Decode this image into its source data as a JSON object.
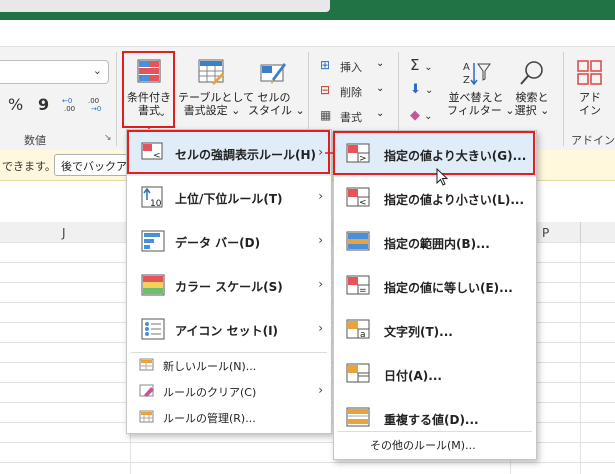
{
  "ribbon": {
    "number_group_label": "数値",
    "percent_symbol": "%",
    "comma_symbol": "9",
    "cond_format_label1": "条件付き",
    "cond_format_label2": "書式",
    "table_format_label1": "テーブルとして",
    "table_format_label2": "書式設定",
    "cell_style_label1": "セルの",
    "cell_style_label2": "スタイル",
    "insert_label": "挿入",
    "delete_label": "削除",
    "format_label": "書式",
    "sort_filter_label1": "並べ替えと",
    "sort_filter_label2": "フィルター",
    "find_select_label1": "検索と",
    "find_select_label2": "選択",
    "addin_label1": "アド",
    "addin_label2": "イン",
    "addin_group_label": "アドイン"
  },
  "infobar": {
    "message": "できます。",
    "button_label": "後でバックアップ"
  },
  "grid": {
    "col_j": "J",
    "col_p": "P"
  },
  "menu_main": {
    "items": [
      {
        "label": "セルの強調表示ルール(H)",
        "icon": "highlight-rules-icon"
      },
      {
        "label": "上位/下位ルール(T)",
        "icon": "top-bottom-icon"
      },
      {
        "label": "データ バー(D)",
        "icon": "data-bar-icon"
      },
      {
        "label": "カラー スケール(S)",
        "icon": "color-scale-icon"
      },
      {
        "label": "アイコン セット(I)",
        "icon": "icon-set-icon"
      }
    ],
    "small_items": [
      {
        "label": "新しいルール(N)..."
      },
      {
        "label": "ルールのクリア(C)"
      },
      {
        "label": "ルールの管理(R)..."
      }
    ]
  },
  "menu_sub": {
    "items": [
      {
        "label": "指定の値より大きい(G)..."
      },
      {
        "label": "指定の値より小さい(L)..."
      },
      {
        "label": "指定の範囲内(B)..."
      },
      {
        "label": "指定の値に等しい(E)..."
      },
      {
        "label": "文字列(T)..."
      },
      {
        "label": "日付(A)..."
      },
      {
        "label": "重複する値(D)..."
      }
    ],
    "footer": "その他のルール(M)..."
  },
  "colors": {
    "excel_green": "#217346",
    "highlight_red": "#e02020",
    "menu_hover": "#e0ecf8",
    "infobar_bg": "#fff8dc"
  }
}
